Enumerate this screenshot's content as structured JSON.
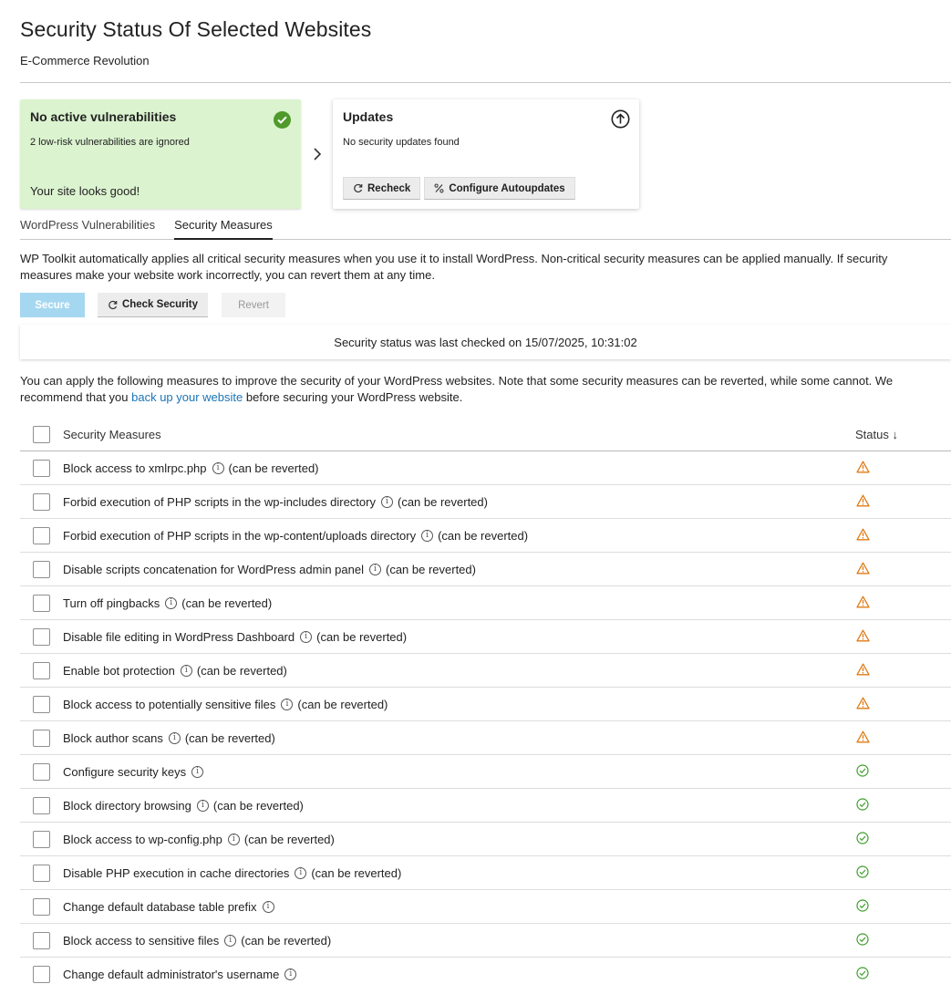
{
  "page": {
    "title": "Security Status Of Selected Websites",
    "subtitle": "E-Commerce Revolution"
  },
  "vuln_card": {
    "title": "No active vulnerabilities",
    "subtitle": "2 low-risk vulnerabilities are ignored",
    "footer": "Your site looks good!"
  },
  "updates_card": {
    "title": "Updates",
    "subtitle": "No security updates found",
    "recheck_label": "Recheck",
    "configure_label": "Configure Autoupdates"
  },
  "tabs": [
    {
      "label": "WordPress Vulnerabilities"
    },
    {
      "label": "Security Measures"
    }
  ],
  "measures": {
    "description": "WP Toolkit automatically applies all critical security measures when you use it to install WordPress. Non-critical security measures can be applied manually. If security measures make your website work incorrectly, you can revert them at any time.",
    "secure_label": "Secure",
    "check_label": "Check Security",
    "revert_label": "Revert",
    "last_checked": "Security status was last checked on 15/07/2025, 10:31:02",
    "desc2_before": "You can apply the following measures to improve the security of your WordPress websites. Note that some security measures can be reverted, while some cannot. We recommend that you ",
    "desc2_link": "back up your website",
    "desc2_after": " before securing your WordPress website."
  },
  "table": {
    "col_measure": "Security Measures",
    "col_status": "Status ↓",
    "rows": [
      {
        "label": "Block access to xmlrpc.php",
        "suffix": "(can be reverted)",
        "status": "warning"
      },
      {
        "label": "Forbid execution of PHP scripts in the wp-includes directory",
        "suffix": "(can be reverted)",
        "status": "warning"
      },
      {
        "label": "Forbid execution of PHP scripts in the wp-content/uploads directory",
        "suffix": "(can be reverted)",
        "status": "warning"
      },
      {
        "label": "Disable scripts concatenation for WordPress admin panel",
        "suffix": "(can be reverted)",
        "status": "warning"
      },
      {
        "label": "Turn off pingbacks",
        "suffix": "(can be reverted)",
        "status": "warning"
      },
      {
        "label": "Disable file editing in WordPress Dashboard",
        "suffix": "(can be reverted)",
        "status": "warning"
      },
      {
        "label": "Enable bot protection",
        "suffix": "(can be reverted)",
        "status": "warning"
      },
      {
        "label": "Block access to potentially sensitive files",
        "suffix": "(can be reverted)",
        "status": "warning"
      },
      {
        "label": "Block author scans",
        "suffix": "(can be reverted)",
        "status": "warning"
      },
      {
        "label": "Configure security keys",
        "suffix": "",
        "status": "ok"
      },
      {
        "label": "Block directory browsing",
        "suffix": "(can be reverted)",
        "status": "ok"
      },
      {
        "label": "Block access to wp-config.php",
        "suffix": "(can be reverted)",
        "status": "ok"
      },
      {
        "label": "Disable PHP execution in cache directories",
        "suffix": "(can be reverted)",
        "status": "ok"
      },
      {
        "label": "Change default database table prefix",
        "suffix": "",
        "status": "ok"
      },
      {
        "label": "Block access to sensitive files",
        "suffix": "(can be reverted)",
        "status": "ok"
      },
      {
        "label": "Change default administrator's username",
        "suffix": "",
        "status": "ok"
      }
    ]
  },
  "colors": {
    "green_card_bg": "#dbf3cf",
    "check_green": "#4f9a2a",
    "warning_orange": "#e07b16",
    "ok_green": "#3f9e2c",
    "link_blue": "#1a75b8",
    "secure_btn_bg": "#a5d8f0"
  }
}
